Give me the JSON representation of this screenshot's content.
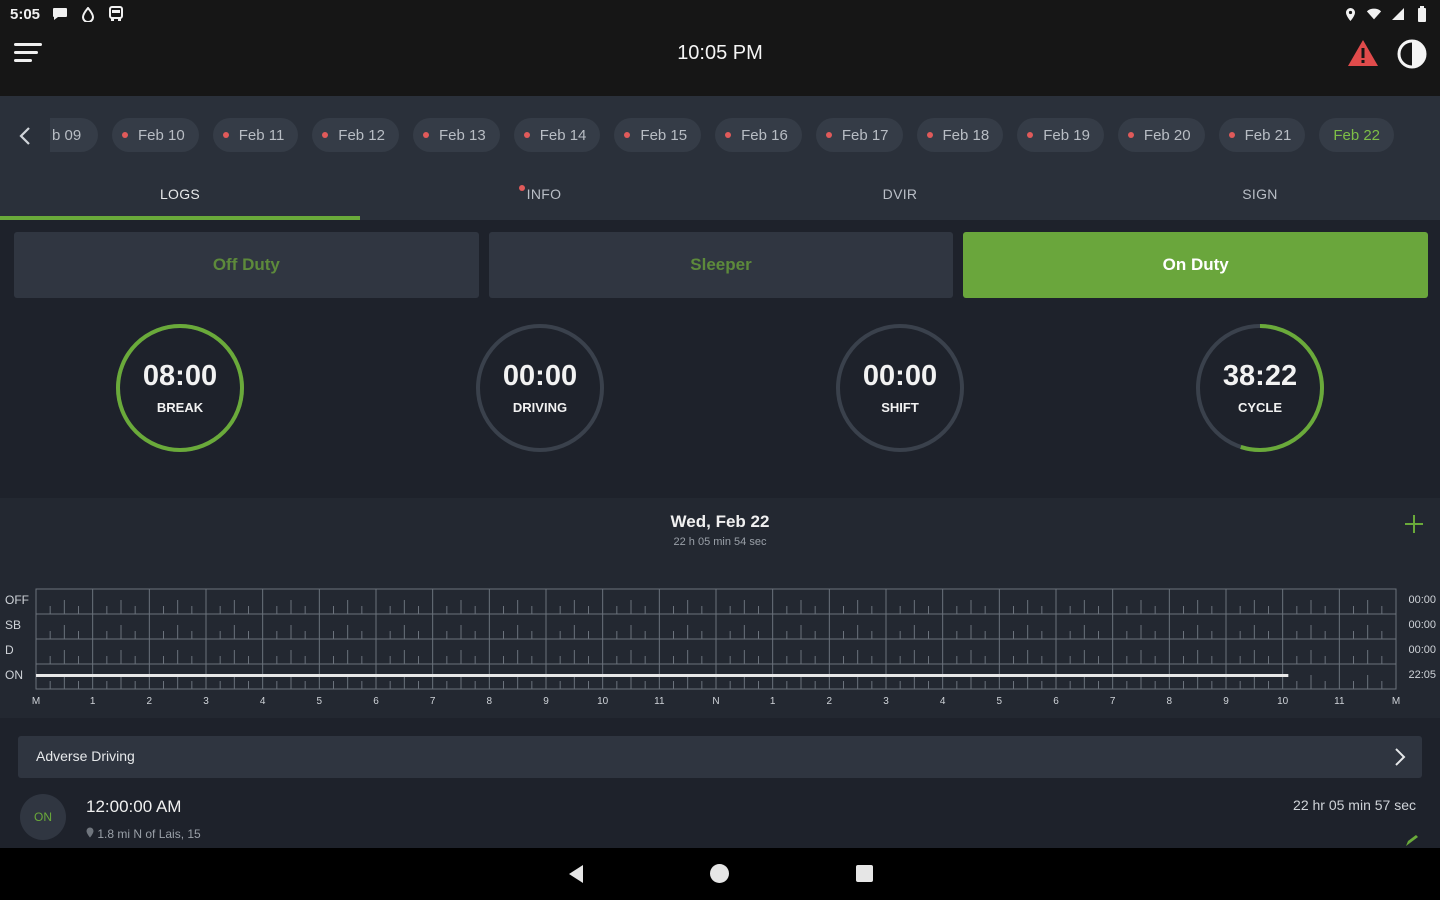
{
  "status_bar": {
    "time": "5:05"
  },
  "app_bar": {
    "title": "10:05 PM"
  },
  "date_strip": {
    "dates": [
      {
        "label": "b 09",
        "flag": false,
        "active": false
      },
      {
        "label": "Feb 10",
        "flag": true,
        "active": false
      },
      {
        "label": "Feb 11",
        "flag": true,
        "active": false
      },
      {
        "label": "Feb 12",
        "flag": true,
        "active": false
      },
      {
        "label": "Feb 13",
        "flag": true,
        "active": false
      },
      {
        "label": "Feb 14",
        "flag": true,
        "active": false
      },
      {
        "label": "Feb 15",
        "flag": true,
        "active": false
      },
      {
        "label": "Feb 16",
        "flag": true,
        "active": false
      },
      {
        "label": "Feb 17",
        "flag": true,
        "active": false
      },
      {
        "label": "Feb 18",
        "flag": true,
        "active": false
      },
      {
        "label": "Feb 19",
        "flag": true,
        "active": false
      },
      {
        "label": "Feb 20",
        "flag": true,
        "active": false
      },
      {
        "label": "Feb 21",
        "flag": true,
        "active": false
      },
      {
        "label": "Feb 22",
        "flag": false,
        "active": true
      }
    ]
  },
  "tabs": [
    {
      "label": "LOGS",
      "active": true,
      "flag": false
    },
    {
      "label": "INFO",
      "active": false,
      "flag": true
    },
    {
      "label": "DVIR",
      "active": false,
      "flag": false
    },
    {
      "label": "SIGN",
      "active": false,
      "flag": false
    }
  ],
  "duty_status": {
    "off_duty": "Off Duty",
    "sleeper": "Sleeper",
    "on_duty": "On Duty",
    "selected": "On Duty"
  },
  "timers": [
    {
      "value": "08:00",
      "label": "BREAK",
      "progress": 1.0
    },
    {
      "value": "00:00",
      "label": "DRIVING",
      "progress": 0.0
    },
    {
      "value": "00:00",
      "label": "SHIFT",
      "progress": 0.0
    },
    {
      "value": "38:22",
      "label": "CYCLE",
      "progress": 0.55
    }
  ],
  "log": {
    "date": "Wed, Feb 22",
    "duration": "22 h 05 min 54 sec",
    "rows": [
      {
        "label": "OFF",
        "total": "00:00"
      },
      {
        "label": "SB",
        "total": "00:00"
      },
      {
        "label": "D",
        "total": "00:00"
      },
      {
        "label": "ON",
        "total": "22:05"
      }
    ],
    "hours": [
      "M",
      "1",
      "2",
      "3",
      "4",
      "5",
      "6",
      "7",
      "8",
      "9",
      "10",
      "11",
      "N",
      "1",
      "2",
      "3",
      "4",
      "5",
      "6",
      "7",
      "8",
      "9",
      "10",
      "11",
      "M"
    ],
    "on_duty_until_hours": 22.1
  },
  "adverse": {
    "label": "Adverse Driving"
  },
  "entry": {
    "badge": "ON",
    "time": "12:00:00 AM",
    "location": "1.8 mi N of Lais, 15",
    "duration": "22 hr 05 min 57 sec"
  },
  "colors": {
    "accent": "#6aaa3a",
    "flag": "#e05a5a",
    "warning": "#e04b4b"
  }
}
